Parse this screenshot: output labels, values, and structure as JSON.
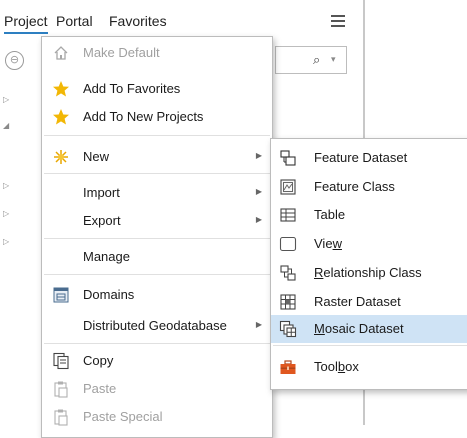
{
  "pane": {
    "tabs": [
      "Project",
      "Portal",
      "Favorites"
    ],
    "back_glyph": "⊖",
    "search_icon": "⌕",
    "dropdown_glyph": "▾",
    "tree_arrows": [
      "▷",
      "◢",
      "▷",
      "▷",
      "▷"
    ]
  },
  "main_menu": {
    "items": [
      {
        "label": "Make Default",
        "icon": "home-icon",
        "disabled": true
      },
      {
        "label": "Add To Favorites",
        "icon": "star-icon"
      },
      {
        "label": "Add To New Projects",
        "icon": "star-icon"
      },
      {
        "label": "New",
        "icon": "sparkle-icon",
        "submenu": true
      },
      {
        "label": "Import",
        "submenu": true
      },
      {
        "label": "Export",
        "submenu": true
      },
      {
        "label": "Manage"
      },
      {
        "label": "Domains",
        "icon": "domains-icon"
      },
      {
        "label": "Distributed Geodatabase",
        "submenu": true
      },
      {
        "label": "Copy",
        "icon": "copy-icon"
      },
      {
        "label": "Paste",
        "icon": "paste-icon",
        "disabled": true
      },
      {
        "label": "Paste Special",
        "icon": "paste-icon",
        "disabled": true
      }
    ],
    "submenu_arrow": "▶"
  },
  "sub_menu": {
    "items": [
      {
        "label": "Feature Dataset",
        "icon": "feature-dataset-icon"
      },
      {
        "label": "Feature Class",
        "icon": "feature-class-icon"
      },
      {
        "label": "Table",
        "icon": "table-icon"
      },
      {
        "label_pre": "Vie",
        "label_acc": "w",
        "label_post": "",
        "icon": "view-icon"
      },
      {
        "label_pre": "",
        "label_acc": "R",
        "label_post": "elationship Class",
        "icon": "relationship-class-icon"
      },
      {
        "label": "Raster Dataset",
        "icon": "raster-dataset-icon"
      },
      {
        "label_pre": "",
        "label_acc": "M",
        "label_post": "osaic Dataset",
        "icon": "mosaic-dataset-icon",
        "highlighted": true
      },
      {
        "label_pre": "Tool",
        "label_acc": "b",
        "label_post": "ox",
        "icon": "toolbox-icon"
      }
    ]
  },
  "colors": {
    "accent": "#2d7fc1",
    "highlight": "#cfe3f5",
    "star": "#f2b705",
    "toolbox": "#e0571f"
  }
}
